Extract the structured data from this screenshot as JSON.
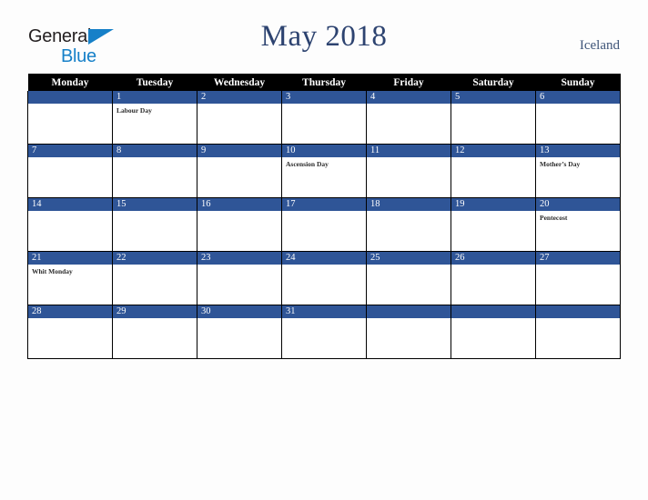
{
  "brand": {
    "word1": "General",
    "word2": "Blue",
    "triangle_color": "#1680c8"
  },
  "header": {
    "title": "May 2018",
    "country": "Iceland",
    "title_color": "#2d4370"
  },
  "calendar": {
    "weekday_headers": [
      "Monday",
      "Tuesday",
      "Wednesday",
      "Thursday",
      "Friday",
      "Saturday",
      "Sunday"
    ],
    "header_bg": "#000000",
    "daybar_bg": "#2f5597",
    "weeks": [
      [
        {
          "day": "",
          "event": ""
        },
        {
          "day": "1",
          "event": "Labour Day"
        },
        {
          "day": "2",
          "event": ""
        },
        {
          "day": "3",
          "event": ""
        },
        {
          "day": "4",
          "event": ""
        },
        {
          "day": "5",
          "event": ""
        },
        {
          "day": "6",
          "event": ""
        }
      ],
      [
        {
          "day": "7",
          "event": ""
        },
        {
          "day": "8",
          "event": ""
        },
        {
          "day": "9",
          "event": ""
        },
        {
          "day": "10",
          "event": "Ascension Day"
        },
        {
          "day": "11",
          "event": ""
        },
        {
          "day": "12",
          "event": ""
        },
        {
          "day": "13",
          "event": "Mother’s Day"
        }
      ],
      [
        {
          "day": "14",
          "event": ""
        },
        {
          "day": "15",
          "event": ""
        },
        {
          "day": "16",
          "event": ""
        },
        {
          "day": "17",
          "event": ""
        },
        {
          "day": "18",
          "event": ""
        },
        {
          "day": "19",
          "event": ""
        },
        {
          "day": "20",
          "event": "Pentecost"
        }
      ],
      [
        {
          "day": "21",
          "event": "Whit Monday"
        },
        {
          "day": "22",
          "event": ""
        },
        {
          "day": "23",
          "event": ""
        },
        {
          "day": "24",
          "event": ""
        },
        {
          "day": "25",
          "event": ""
        },
        {
          "day": "26",
          "event": ""
        },
        {
          "day": "27",
          "event": ""
        }
      ],
      [
        {
          "day": "28",
          "event": ""
        },
        {
          "day": "29",
          "event": ""
        },
        {
          "day": "30",
          "event": ""
        },
        {
          "day": "31",
          "event": ""
        },
        {
          "day": "",
          "event": ""
        },
        {
          "day": "",
          "event": ""
        },
        {
          "day": "",
          "event": ""
        }
      ]
    ]
  }
}
